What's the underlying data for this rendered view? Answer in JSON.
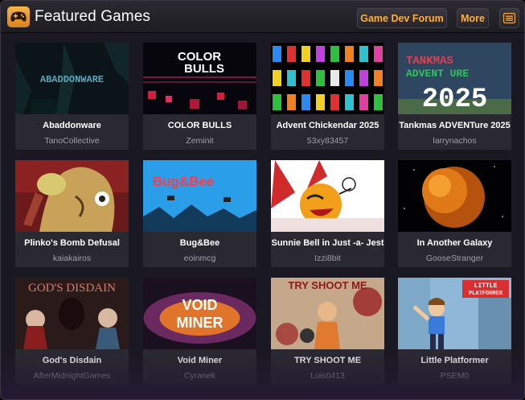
{
  "header": {
    "title": "Featured Games",
    "logo_icon": "game-controller-icon",
    "forum_label": "Game Dev Forum",
    "more_label": "More",
    "menu_icon": "menu-icon"
  },
  "colors": {
    "accent": "#ffb03a",
    "panel_bg": "#1a1822",
    "card_bg": "#2a2932",
    "author_text": "#a19fa8"
  },
  "games": [
    {
      "title": "Abaddonware",
      "author": "TanoCollective",
      "thumb_text": "ABADDONWARE"
    },
    {
      "title": "COLOR BULLS",
      "author": "Zeminit",
      "thumb_text": "COLOR BULLS"
    },
    {
      "title": "Advent Chickendar 2025",
      "author": "53xy83457"
    },
    {
      "title": "Tankmas ADVENTure 2025",
      "author": "larrynachos",
      "thumb_text": "TANKMAS ADVENT URE 2025"
    },
    {
      "title": "Plinko's Bomb Defusal",
      "author": "kaiakairos"
    },
    {
      "title": "Bug&Bee",
      "author": "eoinmcg",
      "thumb_text": "Bug&Bee"
    },
    {
      "title": "Sunnie Bell in Just -a- Jest",
      "author": "Izzi8bit"
    },
    {
      "title": "In Another Galaxy",
      "author": "GooseStranger"
    },
    {
      "title": "God's Disdain",
      "author": "AfterMidnightGames",
      "thumb_text": "GOD'S DISDAIN"
    },
    {
      "title": "Void Miner",
      "author": "Cyranek",
      "thumb_text": "VOID MINER"
    },
    {
      "title": "TRY SHOOT ME",
      "author": "Luis0413",
      "thumb_text": "TRY SHOOT ME"
    },
    {
      "title": "Little Platformer",
      "author": "PSEM0",
      "thumb_text": "LITTLE PLATFORMER"
    }
  ]
}
